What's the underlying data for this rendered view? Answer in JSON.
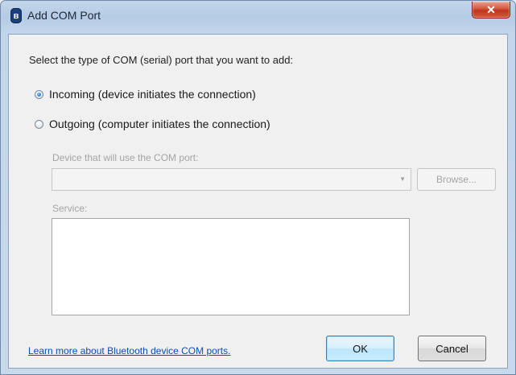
{
  "window": {
    "title": "Add COM Port",
    "icon": "bluetooth-icon",
    "icon_glyph": "ʙ",
    "close_glyph": "✕"
  },
  "dialog": {
    "prompt": "Select the type of COM (serial) port that you want to add:",
    "options": [
      {
        "label": "Incoming (device initiates the connection)",
        "selected": true
      },
      {
        "label": "Outgoing (computer initiates the connection)",
        "selected": false
      }
    ],
    "device_label": "Device that will use the COM port:",
    "device_value": "",
    "browse_label": "Browse...",
    "service_label": "Service:",
    "learn_more_link": "Learn more about Bluetooth device COM ports.",
    "ok_label": "OK",
    "cancel_label": "Cancel"
  },
  "colors": {
    "link": "#0b4fb0",
    "close_button": "#c0341e",
    "titlebar": "#b4cbe5"
  }
}
